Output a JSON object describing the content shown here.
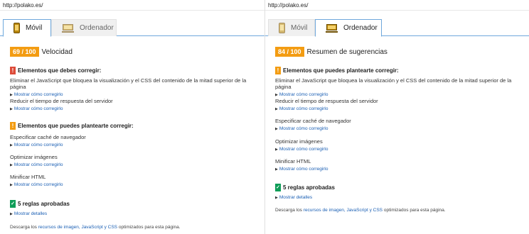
{
  "left": {
    "url": "http://polako.es/",
    "tabs": [
      {
        "label": "Móvil",
        "icon": "phone-icon",
        "active": true
      },
      {
        "label": "Ordenador",
        "icon": "monitor-icon",
        "active": false
      }
    ],
    "score": "69 / 100",
    "score_title": "Velocidad",
    "must_fix": {
      "heading": "Elementos que debes corregir:",
      "items": [
        {
          "text": "Eliminar el JavaScript que bloquea la visualización y el CSS del contenido de la mitad superior de la página",
          "link": "Mostrar cómo corregirlo"
        },
        {
          "text": "Reducir el tiempo de respuesta del servidor",
          "link": "Mostrar cómo corregirlo"
        }
      ]
    },
    "consider_fix": {
      "heading": "Elementos que puedes plantearte corregir:",
      "items": [
        {
          "text": "Especificar caché de navegador",
          "link": "Mostrar cómo corregirlo"
        },
        {
          "text": "Optimizar imágenes",
          "link": "Mostrar cómo corregirlo"
        },
        {
          "text": "Minificar HTML",
          "link": "Mostrar cómo corregirlo"
        }
      ]
    },
    "passed": {
      "heading": "5 reglas aprobadas",
      "link": "Mostrar detalles"
    },
    "footer": {
      "pre": "Descarga los ",
      "link": "recursos de imagen, JavaScript y CSS",
      "post": " optimizados para esta página."
    }
  },
  "right": {
    "url": "http://polako.es/",
    "tabs": [
      {
        "label": "Móvil",
        "icon": "phone-icon",
        "active": false
      },
      {
        "label": "Ordenador",
        "icon": "monitor-icon",
        "active": true
      }
    ],
    "score": "84 / 100",
    "score_title": "Resumen de sugerencias",
    "consider_fix": {
      "heading": "Elementos que puedes plantearte corregir:",
      "items": [
        {
          "text": "Eliminar el JavaScript que bloquea la visualización y el CSS del contenido de la mitad superior de la página",
          "link": "Mostrar cómo corregirlo"
        },
        {
          "text": "Reducir el tiempo de respuesta del servidor",
          "link": "Mostrar cómo corregirlo"
        },
        {
          "text": "Especificar caché de navegador",
          "link": "Mostrar cómo corregirlo"
        },
        {
          "text": "Optimizar imágenes",
          "link": "Mostrar cómo corregirlo"
        },
        {
          "text": "Minificar HTML",
          "link": "Mostrar cómo corregirlo"
        }
      ]
    },
    "passed": {
      "heading": "5 reglas aprobadas",
      "link": "Mostrar detalles"
    },
    "footer": {
      "pre": "Descarga los ",
      "link": "recursos de imagen, JavaScript y CSS",
      "post": " optimizados para esta página."
    }
  },
  "colors": {
    "score": "#f39c12",
    "error": "#dd4b39",
    "warning": "#f39c12",
    "pass": "#0f9d58",
    "link": "#1a5fb4",
    "tab_border": "#6fa8dc"
  }
}
